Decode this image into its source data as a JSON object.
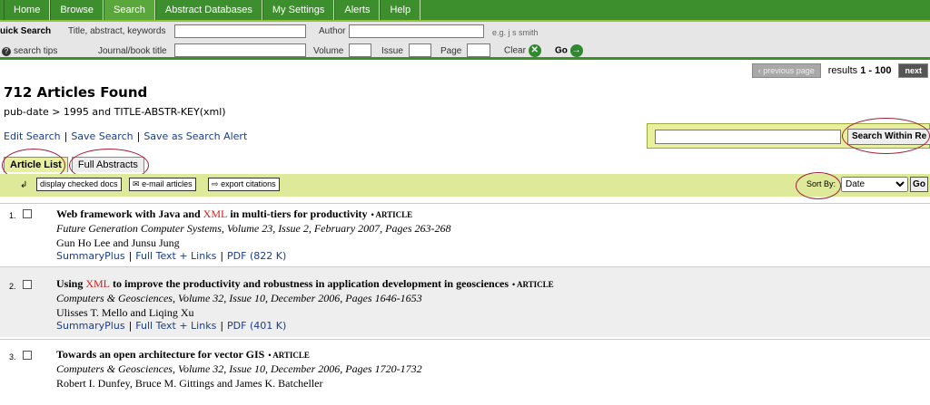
{
  "nav": {
    "tabs": [
      "Home",
      "Browse",
      "Search",
      "Abstract Databases",
      "My Settings",
      "Alerts",
      "Help"
    ],
    "active": "Search"
  },
  "quick_search": {
    "title": "uick Search",
    "field1_label": "Title, abstract, keywords",
    "author_label": "Author",
    "author_hint": "e.g. j s smith",
    "tips_label": "search tips",
    "journal_label": "Journal/book title",
    "volume_label": "Volume",
    "issue_label": "Issue",
    "page_label": "Page",
    "clear_label": "Clear",
    "go_label": "Go"
  },
  "pager": {
    "prev": "previous page",
    "results_prefix": "results",
    "results_range": "1 - 100",
    "next": "next"
  },
  "results": {
    "heading": "712 Articles Found",
    "query": "pub-date > 1995 and TITLE-ABSTR-KEY(xml)",
    "edit": "Edit Search",
    "save": "Save Search",
    "alert": "Save as Search Alert"
  },
  "search_within": {
    "button": "Search Within Re"
  },
  "view_tabs": {
    "list": "Article List",
    "abstracts": "Full Abstracts"
  },
  "toolbar": {
    "display_checked": "display checked docs",
    "email": "e-mail articles",
    "export": "export citations",
    "sort_label": "Sort By:",
    "sort_value": "Date",
    "go": "Go"
  },
  "articles": [
    {
      "num": "1.",
      "title_pre": "Web framework with Java and ",
      "title_hl": "XML",
      "title_post": " in multi-tiers for productivity",
      "type": "• ARTICLE",
      "source": "Future Generation Computer Systems, Volume 23, Issue 2, February 2007, Pages 263-268",
      "authors": "Gun Ho Lee and Junsu Jung",
      "link1": "SummaryPlus",
      "link2": "Full Text + Links",
      "link3": "PDF (822 K)"
    },
    {
      "num": "2.",
      "title_pre": "Using ",
      "title_hl": "XML",
      "title_post": " to improve the productivity and robustness in application development in geosciences",
      "type": "• ARTICLE",
      "source": "Computers & Geosciences, Volume 32, Issue 10, December 2006, Pages 1646-1653",
      "authors": "Ulisses T. Mello and Liqing Xu",
      "link1": "SummaryPlus",
      "link2": "Full Text + Links",
      "link3": "PDF (401 K)"
    },
    {
      "num": "3.",
      "title_pre": "Towards an open architecture for vector GIS",
      "title_hl": "",
      "title_post": "",
      "type": "• ARTICLE",
      "source": "Computers & Geosciences, Volume 32, Issue 10, December 2006, Pages 1720-1732",
      "authors": "Robert I. Dunfey, Bruce M. Gittings and James K. Batcheller"
    }
  ]
}
